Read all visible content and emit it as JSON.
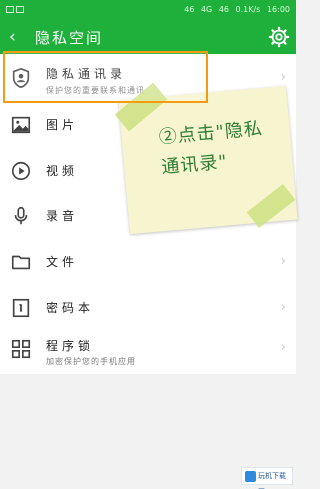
{
  "status_bar": {
    "right_text": [
      "46",
      "4G",
      "46",
      "0.1K/s",
      "16:00"
    ]
  },
  "app_bar": {
    "back": "‹",
    "title": "隐私空间",
    "settings_icon": "gear-icon"
  },
  "items": [
    {
      "label": "隐私通讯录",
      "sub": "保护您的重要联系和通讯",
      "icon": "shield-person-icon"
    },
    {
      "label": "图片",
      "icon": "image-icon"
    },
    {
      "label": "视频",
      "icon": "play-circle-icon"
    },
    {
      "label": "录音",
      "icon": "microphone-icon"
    },
    {
      "label": "文件",
      "icon": "folder-icon"
    },
    {
      "label": "密码本",
      "icon": "notebook-icon"
    },
    {
      "label": "程序锁",
      "sub": "加密保护您的手机应用",
      "icon": "app-grid-icon"
    }
  ],
  "annotation": {
    "text": "②点击\"隐私通讯录\""
  },
  "watermark": {
    "text": "玩机下载网"
  },
  "colors": {
    "primary_green": "#1fb03c",
    "highlight_orange": "#f39c12",
    "note_text_green": "#2f7d33"
  }
}
